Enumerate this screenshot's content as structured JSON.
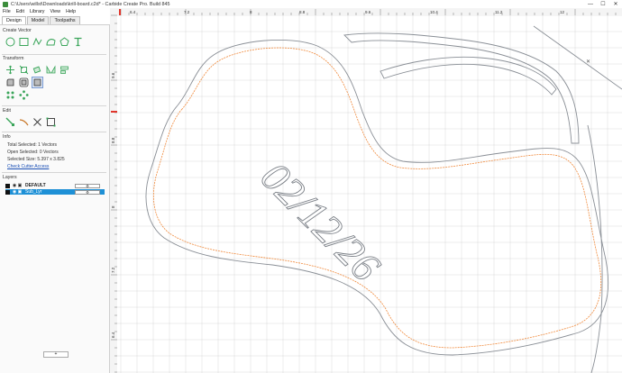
{
  "window": {
    "title": "C:\\Users\\willst\\Downloads\\krill-board.c2d* - Carbide Create Pro. Build 845",
    "minimize": "—",
    "maximize": "☐",
    "close": "✕"
  },
  "menu": [
    "File",
    "Edit",
    "Library",
    "View",
    "Help"
  ],
  "tabs": [
    {
      "label": "Design",
      "active": true
    },
    {
      "label": "Model",
      "active": false
    },
    {
      "label": "Toolpaths",
      "active": false
    }
  ],
  "sections": {
    "create_vector": "Create Vector",
    "transform": "Transform",
    "edit": "Edit",
    "info": "Info",
    "layers": "Layers"
  },
  "create_vector_icons": [
    "circle-icon",
    "square-icon",
    "curve-icon",
    "polygon-icon",
    "pentagon-icon",
    "text-icon"
  ],
  "transform_icons_row1": [
    "move-icon",
    "scale-icon",
    "rotate-icon",
    "mirror-icon",
    "align-icon"
  ],
  "transform_icons_row2": [
    "fillet-icon",
    "offset-icon",
    "boolean-icon"
  ],
  "transform_icons_row3": [
    "array-icon",
    "circular-array-icon"
  ],
  "edit_icons": [
    "node-edit-icon",
    "trim-icon",
    "cut-icon",
    "bounding-box-icon"
  ],
  "info": {
    "total_selected": "Total Selected:   1 Vectors",
    "open_selected": "Open Selected:   0 Vectors",
    "selected_size": "Selected Size:   5.397 x 3.825",
    "cutter_link": "Check Cutter Access"
  },
  "layers": [
    {
      "name": "DEFAULT",
      "selected": false
    },
    {
      "name": "Sub_Lyr",
      "selected": true
    }
  ],
  "add_layer_label": "+",
  "ruler": {
    "top_labels": [
      "6.4",
      "7.2",
      "8",
      "8.8",
      "9.6",
      "10.4",
      "11.2",
      "12"
    ],
    "left_labels": [
      "9.6",
      "8.8",
      "8",
      "7.2",
      "6.4"
    ]
  },
  "canvas": {
    "engraving_text": "02/12/26",
    "outline_color": "#8a8f96",
    "toolpath_color": "#f08a3c",
    "grid_color": "#d9d9d9",
    "ruler_marker_color": "#e0352b"
  }
}
